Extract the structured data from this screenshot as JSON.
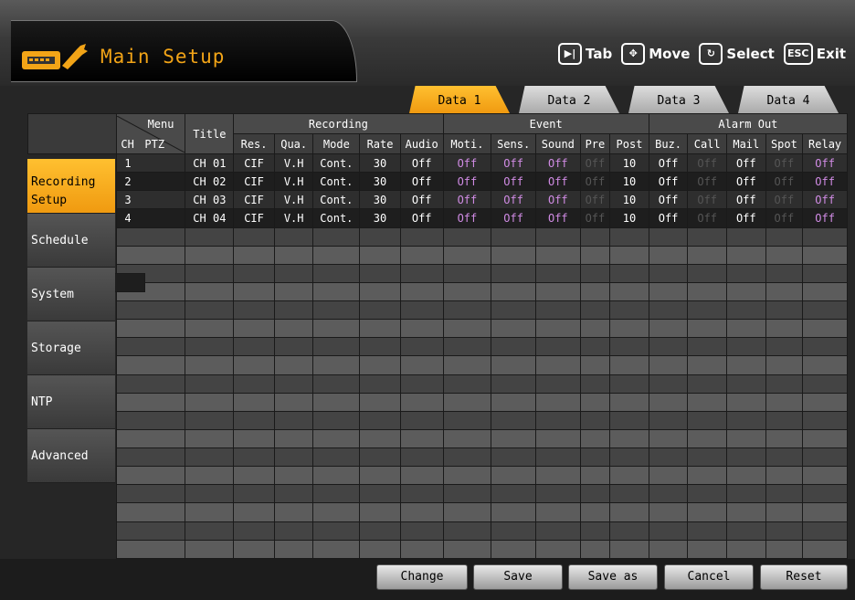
{
  "header": {
    "title": "Main Setup",
    "icon": "dvr-settings-icon",
    "hints": [
      {
        "icon": "tab-key-icon",
        "label": "Tab"
      },
      {
        "icon": "move-arrows-icon",
        "label": "Move"
      },
      {
        "icon": "select-key-icon",
        "label": "Select"
      },
      {
        "icon": "esc-key-icon",
        "label": "Exit"
      }
    ]
  },
  "tabs": [
    {
      "label": "Data 1",
      "active": true
    },
    {
      "label": "Data 2"
    },
    {
      "label": "Data 3"
    },
    {
      "label": "Data 4"
    }
  ],
  "table": {
    "menu_label": "Menu",
    "ch_label": "CH",
    "ptz_label": "PTZ",
    "title_label": "Title",
    "groups": [
      "Recording",
      "Event",
      "Alarm Out"
    ],
    "columns": [
      "Res.",
      "Qua.",
      "Mode",
      "Rate",
      "Audio",
      "Moti.",
      "Sens.",
      "Sound",
      "Pre",
      "Post",
      "Buz.",
      "Call",
      "Mail",
      "Spot",
      "Relay"
    ],
    "rows": [
      {
        "ch": "1",
        "title": "CH 01",
        "res": "CIF",
        "qua": "V.H",
        "mode": "Cont.",
        "rate": "30",
        "audio": "Off",
        "moti": "Off",
        "sens": "Off",
        "sound": "Off",
        "pre": "Off",
        "post": "10",
        "buz": "Off",
        "call": "Off",
        "mail": "Off",
        "spot": "Off",
        "relay": "Off"
      },
      {
        "ch": "2",
        "title": "CH 02",
        "res": "CIF",
        "qua": "V.H",
        "mode": "Cont.",
        "rate": "30",
        "audio": "Off",
        "moti": "Off",
        "sens": "Off",
        "sound": "Off",
        "pre": "Off",
        "post": "10",
        "buz": "Off",
        "call": "Off",
        "mail": "Off",
        "spot": "Off",
        "relay": "Off"
      },
      {
        "ch": "3",
        "title": "CH 03",
        "res": "CIF",
        "qua": "V.H",
        "mode": "Cont.",
        "rate": "30",
        "audio": "Off",
        "moti": "Off",
        "sens": "Off",
        "sound": "Off",
        "pre": "Off",
        "post": "10",
        "buz": "Off",
        "call": "Off",
        "mail": "Off",
        "spot": "Off",
        "relay": "Off"
      },
      {
        "ch": "4",
        "title": "CH 04",
        "res": "CIF",
        "qua": "V.H",
        "mode": "Cont.",
        "rate": "30",
        "audio": "Off",
        "moti": "Off",
        "sens": "Off",
        "sound": "Off",
        "pre": "Off",
        "post": "10",
        "buz": "Off",
        "call": "Off",
        "mail": "Off",
        "spot": "Off",
        "relay": "Off"
      }
    ]
  },
  "sidebar": {
    "items": [
      {
        "line1": "Recording",
        "line2": "Setup",
        "active": true
      },
      {
        "line1": "Schedule"
      },
      {
        "line1": "System"
      },
      {
        "line1": "Storage"
      },
      {
        "line1": "NTP"
      },
      {
        "line1": "Advanced"
      }
    ]
  },
  "buttons": [
    "Change",
    "Save",
    "Save as",
    "Cancel",
    "Reset"
  ],
  "colors": {
    "accent": "#f2a417",
    "off_event": "#d28ce6"
  }
}
